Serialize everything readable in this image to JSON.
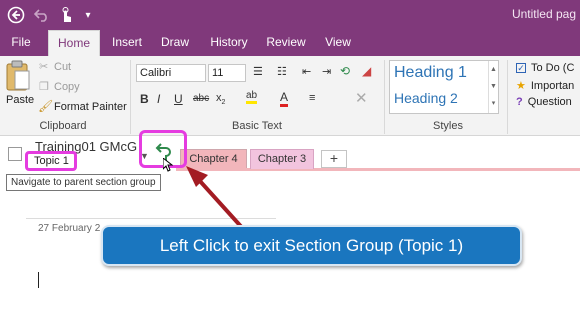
{
  "titlebar": {
    "document_title": "Untitled pag",
    "qat_icons": [
      "back-icon",
      "undo-icon",
      "touch-mode-icon",
      "customize-qat-icon"
    ]
  },
  "ribbon_tabs": [
    {
      "label": "File"
    },
    {
      "label": "Home",
      "active": true
    },
    {
      "label": "Insert"
    },
    {
      "label": "Draw"
    },
    {
      "label": "History"
    },
    {
      "label": "Review"
    },
    {
      "label": "View"
    }
  ],
  "clipboard": {
    "paste_label": "Paste",
    "cut_label": "Cut",
    "copy_label": "Copy",
    "format_painter_label": "Format Painter",
    "group_label": "Clipboard"
  },
  "basic_text": {
    "font_name": "Calibri",
    "font_size": "11",
    "bold": "B",
    "italic": "I",
    "underline": "U",
    "strikethrough": "abc",
    "subscript": "x",
    "highlight": "ab",
    "font_color": "A",
    "group_label": "Basic Text"
  },
  "styles": {
    "heading1": "Heading 1",
    "heading2": "Heading 2",
    "group_label": "Styles"
  },
  "tags": {
    "items": [
      "To Do (C",
      "Importan",
      "Question"
    ]
  },
  "notebook": {
    "name": "Training01 GMcG",
    "section_group": "Topic 1",
    "sections": [
      "Chapter 4",
      "Chapter 3"
    ],
    "add_section_label": "+",
    "tooltip": "Navigate to parent section group"
  },
  "page": {
    "date": "27 February 2"
  },
  "callout": {
    "text": "Left Click to exit Section Group (Topic 1)"
  },
  "colors": {
    "brand": "#80397b",
    "highlight_border": "#e53ce0",
    "callout_bg": "#1a76bf",
    "arrow": "#a31c23",
    "section_tab_chapter4": "#f2b6bb",
    "section_tab_chapter3": "#f2c4de"
  }
}
